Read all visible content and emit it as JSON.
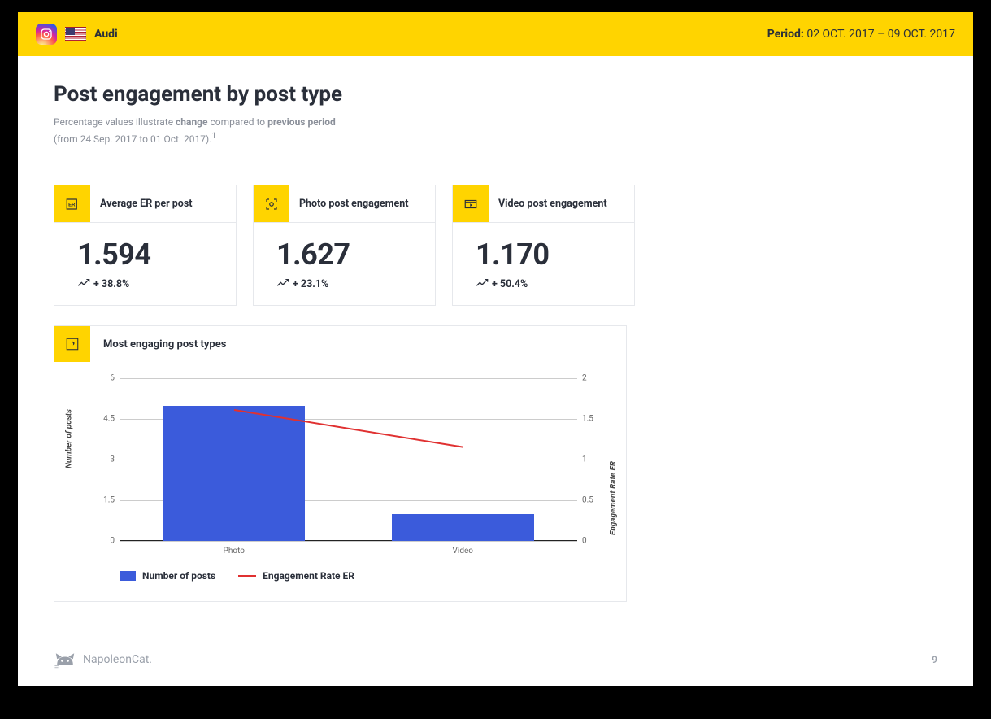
{
  "header": {
    "brand": "Audi",
    "period_label": "Period:",
    "period_value": "02 OCT. 2017 – 09 OCT. 2017"
  },
  "title": "Post engagement by post type",
  "subtitle": {
    "prefix": "Percentage values illustrate ",
    "bold1": "change",
    "mid": " compared to ",
    "bold2": "previous period",
    "line2": "(from 24 Sep. 2017 to 01 Oct. 2017).",
    "footmark": "1"
  },
  "cards": [
    {
      "label": "Average ER per post",
      "value": "1.594",
      "change": "+ 38.8%"
    },
    {
      "label": "Photo post engagement",
      "value": "1.627",
      "change": "+ 23.1%"
    },
    {
      "label": "Video post engagement",
      "value": "1.170",
      "change": "+ 50.4%"
    }
  ],
  "chart_section": {
    "title": "Most engaging post types",
    "ylabel": "Number of posts",
    "ylabel2": "Engagement Rate ER",
    "legend_bar": "Number of posts",
    "legend_line": "Engagement Rate ER"
  },
  "chart_data": {
    "type": "bar",
    "categories": [
      "Photo",
      "Video"
    ],
    "series": [
      {
        "name": "Number of posts",
        "axis": "left",
        "type": "bar",
        "values": [
          5,
          1
        ]
      },
      {
        "name": "Engagement Rate ER",
        "axis": "right",
        "type": "line",
        "values": [
          1.627,
          1.17
        ]
      }
    ],
    "title": "Most engaging post types",
    "xlabel": "",
    "ylabel": "Number of posts",
    "ylim": [
      0,
      6
    ],
    "yticks": [
      0,
      1.5,
      3,
      4.5,
      6
    ],
    "y2label": "Engagement Rate ER",
    "y2lim": [
      0,
      2
    ],
    "y2ticks": [
      0,
      0.5,
      1,
      1.5,
      2
    ]
  },
  "footer": {
    "logo_text": "NapoleonCat.",
    "page": "9"
  }
}
